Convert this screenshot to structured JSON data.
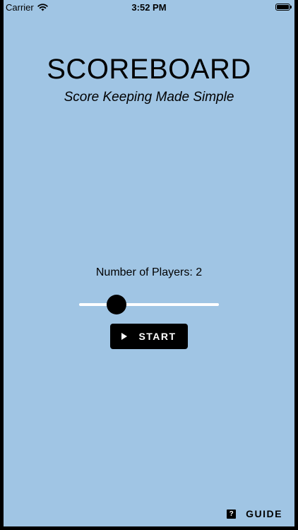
{
  "status_bar": {
    "carrier": "Carrier",
    "time": "3:52 PM",
    "battery_level": 1.0,
    "wifi_icon": "wifi-icon",
    "battery_icon": "battery-icon"
  },
  "header": {
    "title": "SCOREBOARD",
    "subtitle": "Score Keeping Made Simple"
  },
  "players": {
    "label": "Number of Players: 2",
    "slider": {
      "value": 2,
      "min": 1,
      "max": 8
    }
  },
  "start_button": {
    "label": "START",
    "icon": "play-icon"
  },
  "guide_button": {
    "label": "GUIDE",
    "icon": "help-icon",
    "icon_glyph": "?"
  },
  "colors": {
    "background": "#a0c5e4",
    "button": "#000000",
    "slider_track": "#ffffff",
    "slider_thumb": "#000000"
  }
}
